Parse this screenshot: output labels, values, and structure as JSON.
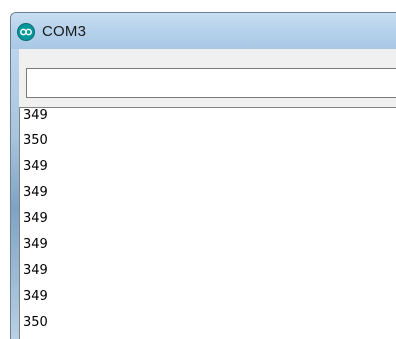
{
  "window": {
    "title": "COM3",
    "icon": "arduino-infinity-icon",
    "accent_color": "#00979c"
  },
  "input": {
    "value": "",
    "placeholder": ""
  },
  "output": {
    "lines": [
      "349",
      "350",
      "349",
      "349",
      "349",
      "349",
      "349",
      "349",
      "350"
    ]
  }
}
